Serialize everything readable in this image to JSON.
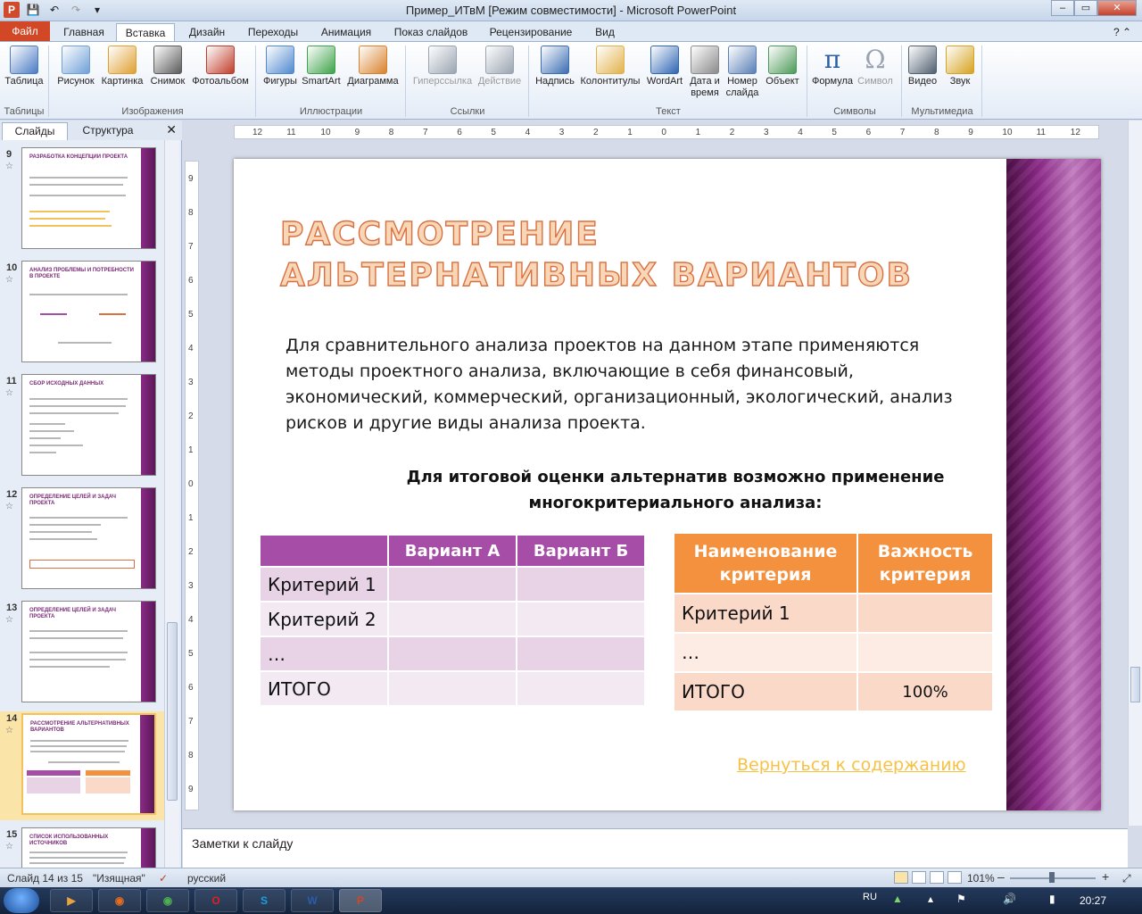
{
  "window": {
    "title": "Пример_ИТвМ [Режим совместимости] - Microsoft PowerPoint",
    "min": "–",
    "max": "▭",
    "close": "✕"
  },
  "ribbon_tabs": [
    "Файл",
    "Главная",
    "Вставка",
    "Дизайн",
    "Переходы",
    "Анимация",
    "Показ слайдов",
    "Рецензирование",
    "Вид"
  ],
  "ribbon": {
    "buttons": [
      {
        "label": "Таблица",
        "color": "#4a7cc4"
      },
      {
        "label": "Рисунок",
        "color": "#6fa0d8"
      },
      {
        "label": "Картинка",
        "color": "#e0a030"
      },
      {
        "label": "Снимок",
        "color": "#5b5b5b"
      },
      {
        "label": "Фотоальбом",
        "color": "#c03c2a"
      },
      {
        "label": "Фигуры",
        "color": "#4f89cf"
      },
      {
        "label": "SmartArt",
        "color": "#3da34a"
      },
      {
        "label": "Диаграмма",
        "color": "#d9822b"
      },
      {
        "label": "Гиперссылка",
        "color": "#9aa4b0"
      },
      {
        "label": "Действие",
        "color": "#9aa4b0"
      },
      {
        "label": "Надпись",
        "color": "#3b6db3"
      },
      {
        "label": "Колонтитулы",
        "color": "#e2b24a"
      },
      {
        "label": "WordArt",
        "color": "#2f66b3"
      },
      {
        "label": "Дата и\nвремя",
        "color": "#8a8a8a"
      },
      {
        "label": "Номер\nслайда",
        "color": "#5a7fb5"
      },
      {
        "label": "Объект",
        "color": "#4c9a58"
      },
      {
        "label": "Формула",
        "color": "#2d5fa8"
      },
      {
        "label": "Символ",
        "color": "#9aa4b0"
      },
      {
        "label": "Видео",
        "color": "#506070"
      },
      {
        "label": "Звук",
        "color": "#d7a21e"
      }
    ],
    "groups": [
      "Таблицы",
      "Изображения",
      "Иллюстрации",
      "Ссылки",
      "Текст",
      "Символы",
      "Мультимедиа"
    ]
  },
  "left_panel": {
    "tabs": [
      "Слайды",
      "Структура"
    ],
    "close": "✕",
    "thumbs": [
      {
        "num": "9",
        "title": "РАЗРАБОТКА КОНЦЕПЦИИ ПРОЕКТА"
      },
      {
        "num": "10",
        "title": "АНАЛИЗ ПРОБЛЕМЫ И ПОТРЕБНОСТИ В ПРОЕКТЕ"
      },
      {
        "num": "11",
        "title": "СБОР ИСХОДНЫХ ДАННЫХ"
      },
      {
        "num": "12",
        "title": "ОПРЕДЕЛЕНИЕ ЦЕЛЕЙ И ЗАДАЧ ПРОЕКТА"
      },
      {
        "num": "13",
        "title": "ОПРЕДЕЛЕНИЕ ЦЕЛЕЙ И ЗАДАЧ ПРОЕКТА"
      },
      {
        "num": "14",
        "title": "РАССМОТРЕНИЕ АЛЬТЕРНАТИВНЫХ ВАРИАНТОВ"
      },
      {
        "num": "15",
        "title": "СПИСОК ИСПОЛЬЗОВАННЫХ ИСТОЧНИКОВ"
      }
    ]
  },
  "ruler": {
    "h_ticks": [
      "12",
      "11",
      "10",
      "9",
      "8",
      "7",
      "6",
      "5",
      "4",
      "3",
      "2",
      "1",
      "0",
      "1",
      "2",
      "3",
      "4",
      "5",
      "6",
      "7",
      "8",
      "9",
      "10",
      "11",
      "12"
    ],
    "v_ticks": [
      "9",
      "8",
      "7",
      "6",
      "5",
      "4",
      "3",
      "2",
      "1",
      "0",
      "1",
      "2",
      "3",
      "4",
      "5",
      "6",
      "7",
      "8",
      "9"
    ]
  },
  "slide": {
    "title": "Рассмотрение альтернативных вариантов",
    "body": "Для сравнительного анализа проектов на данном этапе применяются методы проектного анализа, включающие в себя финансовый, экономический, коммерческий, организационный, экологический, анализ рисков и другие виды анализа проекта.",
    "subheading": "Для итоговой оценки альтернатив возможно применение многокритериального анализа:",
    "table1": {
      "headers": [
        "",
        "Вариант А",
        "Вариант Б"
      ],
      "rows": [
        "Критерий 1",
        "Критерий 2",
        "…",
        "ИТОГО"
      ]
    },
    "table2": {
      "headers": [
        "Наименование критерия",
        "Важность критерия"
      ],
      "rows": [
        {
          "name": "Критерий 1",
          "value": ""
        },
        {
          "name": "…",
          "value": ""
        },
        {
          "name": "ИТОГО",
          "value": "100%"
        }
      ]
    },
    "back_link": "Вернуться к содержанию",
    "colors": {
      "band": "#8f2c8b",
      "table1_header": "#a64ea7",
      "table2_header": "#f3913e",
      "link": "#f7c244",
      "title_fill": "#f8d6b8",
      "title_outline": "#d9703f"
    }
  },
  "notes_placeholder": "Заметки к слайду",
  "status": {
    "slide_info": "Слайд 14 из 15",
    "theme": "\"Изящная\"",
    "language": "русский",
    "zoom": "101%",
    "zoom_minus": "–",
    "zoom_plus": "+"
  },
  "taskbar": {
    "apps": [
      {
        "name": "media",
        "glyph": "▶",
        "color": "#e8a33a"
      },
      {
        "name": "firefox",
        "glyph": "◉",
        "color": "#e66b1f"
      },
      {
        "name": "chrome",
        "glyph": "◉",
        "color": "#4caf50"
      },
      {
        "name": "opera",
        "glyph": "O",
        "color": "#e02020"
      },
      {
        "name": "skype",
        "glyph": "S",
        "color": "#1aa0e0"
      },
      {
        "name": "word",
        "glyph": "W",
        "color": "#2b5cab"
      },
      {
        "name": "powerpoint",
        "glyph": "P",
        "color": "#d24726"
      }
    ],
    "lang": "RU",
    "clock": "20:27"
  }
}
